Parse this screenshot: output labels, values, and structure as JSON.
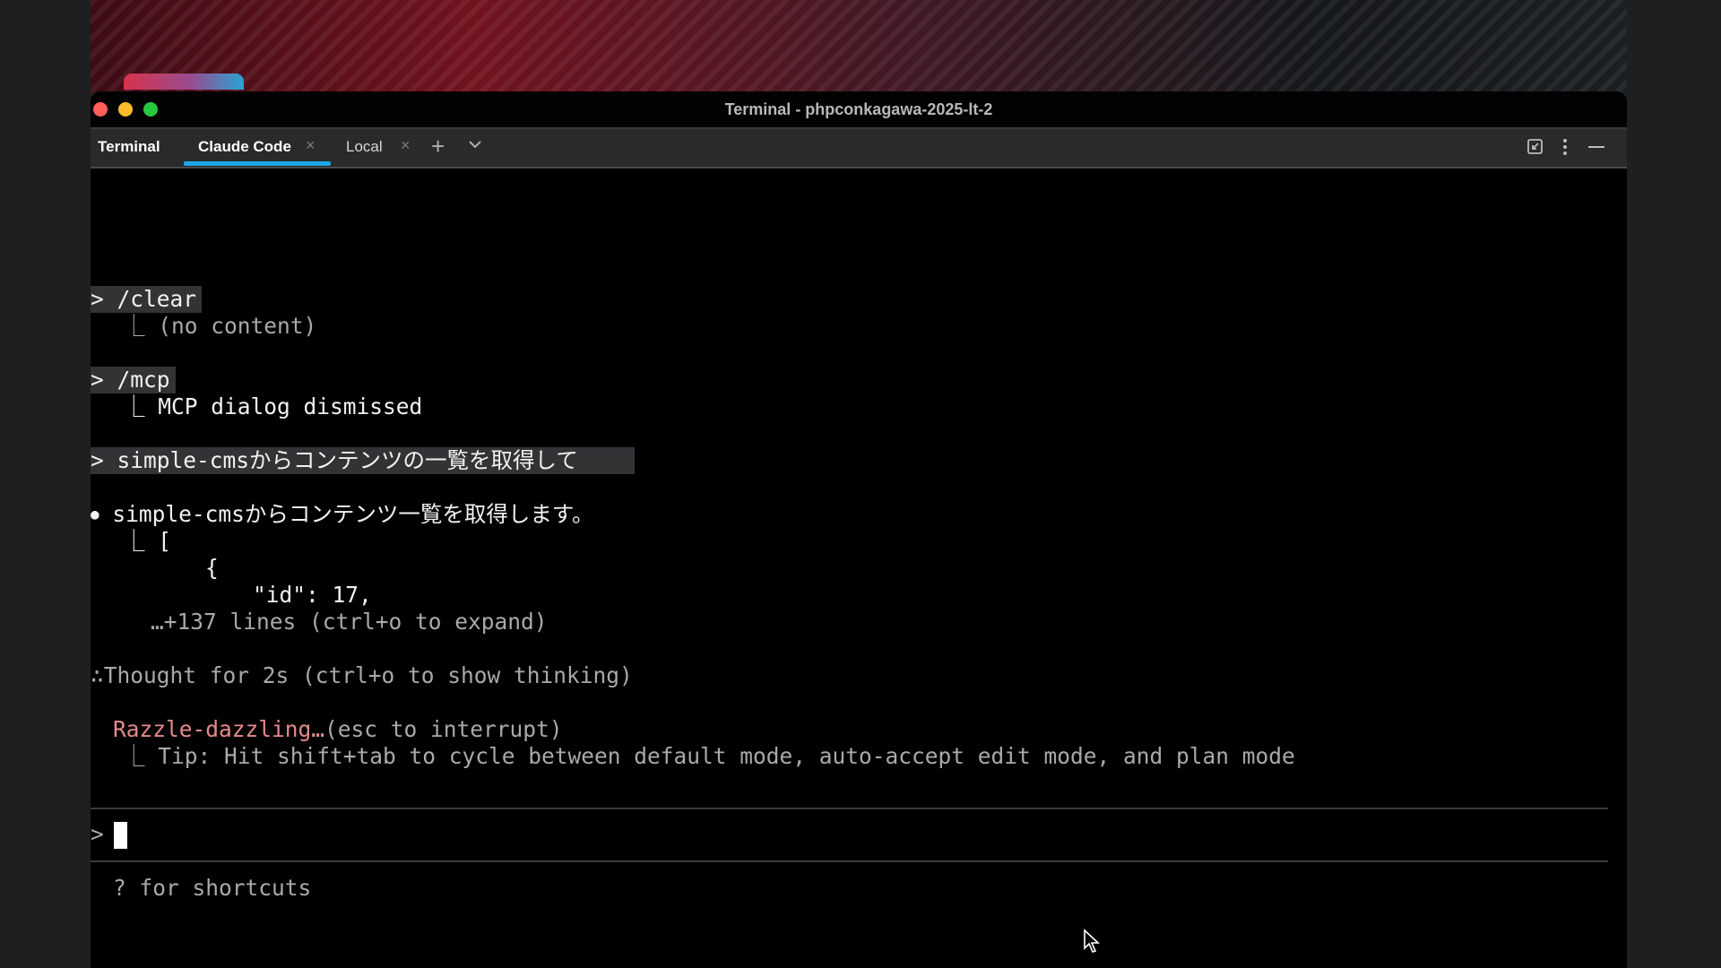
{
  "window": {
    "title": "Terminal - phpconkagawa-2025-lt-2"
  },
  "tabs": {
    "app_label": "Terminal",
    "items": [
      {
        "label": "Claude Code",
        "active": true
      },
      {
        "label": "Local",
        "active": false
      }
    ],
    "close_glyph": "×",
    "add_glyph": "+"
  },
  "terminal": {
    "prompt_char": ">",
    "result_prefix": "⎿",
    "commands": [
      {
        "input": "/clear",
        "output": "(no content)"
      },
      {
        "input": "/mcp",
        "output": "MCP dialog dismissed"
      },
      {
        "input": "simple-cmsからコンテンツの一覧を取得して"
      }
    ],
    "assistant": {
      "bullet": "●",
      "message": "simple-cmsからコンテンツ一覧を取得します。",
      "json_line1": "[",
      "json_line2": "{",
      "json_line3": "\"id\": 17,",
      "collapsed": "…+137 lines (ctrl+o to expand)"
    },
    "thinking": "∴Thought for 2s (ctrl+o to show thinking)",
    "status": {
      "spinner_word": "Razzle-dazzling…",
      "hint": "(esc to interrupt)",
      "tip": "Tip: Hit shift+tab to cycle between default mode, auto-accept edit mode, and plan mode"
    },
    "shortcuts_hint": "? for shortcuts"
  },
  "colors": {
    "tab_accent": "#1aa6e6",
    "spinner": "#e58a8a",
    "background": "#000000"
  }
}
